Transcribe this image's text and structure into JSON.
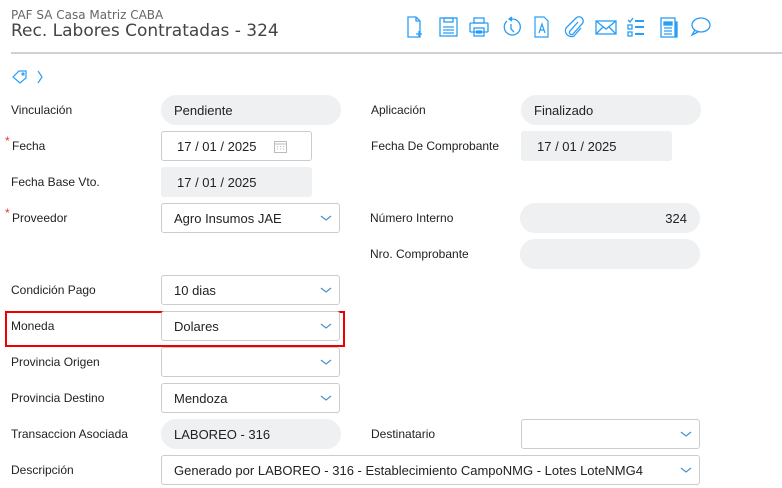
{
  "header": {
    "company": "PAF SA Casa Matriz CABA",
    "title": "Rec. Labores Contratadas - 324"
  },
  "toolbar": [
    "new-document",
    "save",
    "print",
    "history",
    "text-document",
    "attachment",
    "email",
    "checklist",
    "report",
    "comments"
  ],
  "colors": {
    "accent": "#2a9df4",
    "highlight": "#e00000"
  },
  "fields": {
    "vinculacion": {
      "label": "Vinculación",
      "value": "Pendiente"
    },
    "aplicacion": {
      "label": "Aplicación",
      "value": "Finalizado"
    },
    "fecha": {
      "label": "Fecha",
      "value": "17 / 01 / 2025"
    },
    "fecha_comprobante": {
      "label": "Fecha De Comprobante",
      "value": "17 / 01 / 2025"
    },
    "fecha_base": {
      "label": "Fecha Base Vto.",
      "value": "17 / 01 / 2025"
    },
    "proveedor": {
      "label": "Proveedor",
      "value": "Agro Insumos JAE"
    },
    "numero_interno": {
      "label": "Número Interno",
      "value": "324"
    },
    "nro_comprobante": {
      "label": "Nro. Comprobante",
      "value": ""
    },
    "condicion_pago": {
      "label": "Condición Pago",
      "value": "10 dias"
    },
    "moneda": {
      "label": "Moneda",
      "value": "Dolares"
    },
    "provincia_origen": {
      "label": "Provincia Origen",
      "value": ""
    },
    "provincia_destino": {
      "label": "Provincia Destino",
      "value": "Mendoza"
    },
    "transaccion": {
      "label": "Transaccion Asociada",
      "value": "LABOREO - 316"
    },
    "destinatario": {
      "label": "Destinatario",
      "value": ""
    },
    "descripcion": {
      "label": "Descripción",
      "value": "Generado por LABOREO - 316 - Establecimiento CampoNMG - Lotes LoteNMG4"
    }
  }
}
